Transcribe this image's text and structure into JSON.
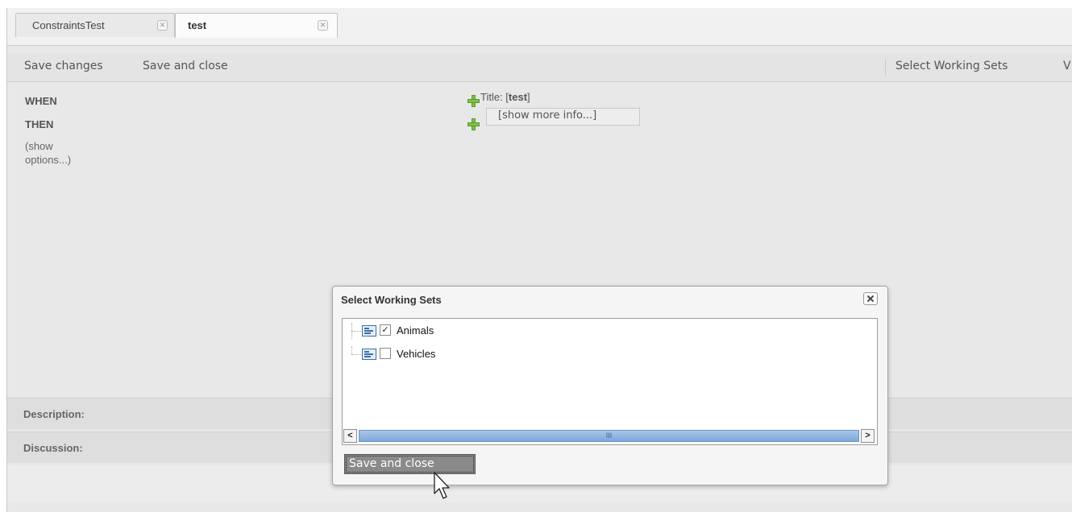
{
  "tabs": [
    {
      "label": "ConstraintsTest",
      "active": false
    },
    {
      "label": "test",
      "active": true
    }
  ],
  "toolbar": {
    "save_changes": "Save changes",
    "save_and_close": "Save and close",
    "select_working_sets": "Select Working Sets",
    "truncated_item": "V"
  },
  "rule": {
    "when": "WHEN",
    "then": "THEN",
    "show_options": "(show options...)",
    "title_prefix": "Title: [",
    "title_value": "test",
    "title_suffix": "]",
    "more_info": "[show more info...]"
  },
  "sections": {
    "description": "Description:",
    "discussion": "Discussion:"
  },
  "dialog": {
    "title": "Select Working Sets",
    "items": [
      {
        "label": "Animals",
        "checked": true
      },
      {
        "label": "Vehicles",
        "checked": false
      }
    ],
    "scroll_thumb_glyph": "III",
    "scroll_left": "<",
    "scroll_right": ">",
    "save_button": "Save and close"
  },
  "colors": {
    "workspace": "#e8e8e8",
    "scroll_thumb": "#8fb2e2",
    "plus_icon": "#7fbf4d",
    "dialog_button": "#8a8a8a"
  }
}
